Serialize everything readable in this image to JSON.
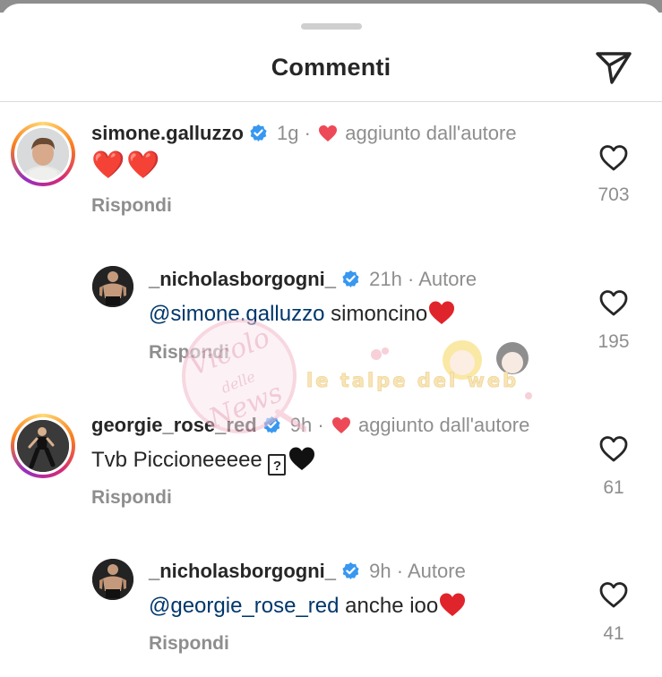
{
  "sheet": {
    "title": "Commenti"
  },
  "icons": {
    "share": "paper-plane-icon",
    "like": "heart-outline-icon",
    "verified": "verified-badge-icon",
    "author_like": "red-heart-icon"
  },
  "colors": {
    "verified": "#3897f0",
    "heart": "#ed4956",
    "mention": "#00376b",
    "meta": "#8e8e8e"
  },
  "comments": [
    {
      "username": "simone.galluzzo",
      "time": "1g",
      "dot": "·",
      "author_note": "aggiunto dall'autore",
      "text": "❤️❤️",
      "reply": "Rispondi",
      "likes": "703"
    },
    {
      "username": "_nicholasborgogni_",
      "time": "21h",
      "dot": "·",
      "author_label": "Autore",
      "mention": "@simone.galluzzo",
      "text": " simoncino",
      "reply": "Rispondi",
      "likes": "195"
    },
    {
      "username": "georgie_rose_red",
      "time": "9h",
      "dot": "·",
      "author_note": "aggiunto dall'autore",
      "text": "Tvb Piccioneeeee ",
      "glyph": "?",
      "reply": "Rispondi",
      "likes": "61"
    },
    {
      "username": "_nicholasborgogni_",
      "time": "9h",
      "dot": "·",
      "author_label": "Autore",
      "mention": "@georgie_rose_red",
      "text": " anche ioo",
      "reply": "Rispondi",
      "likes": "41"
    }
  ],
  "watermarks": {
    "left_logo": {
      "lines": [
        "Vicolo",
        "delle",
        "News"
      ]
    },
    "right_logo": "le talpe del web"
  }
}
